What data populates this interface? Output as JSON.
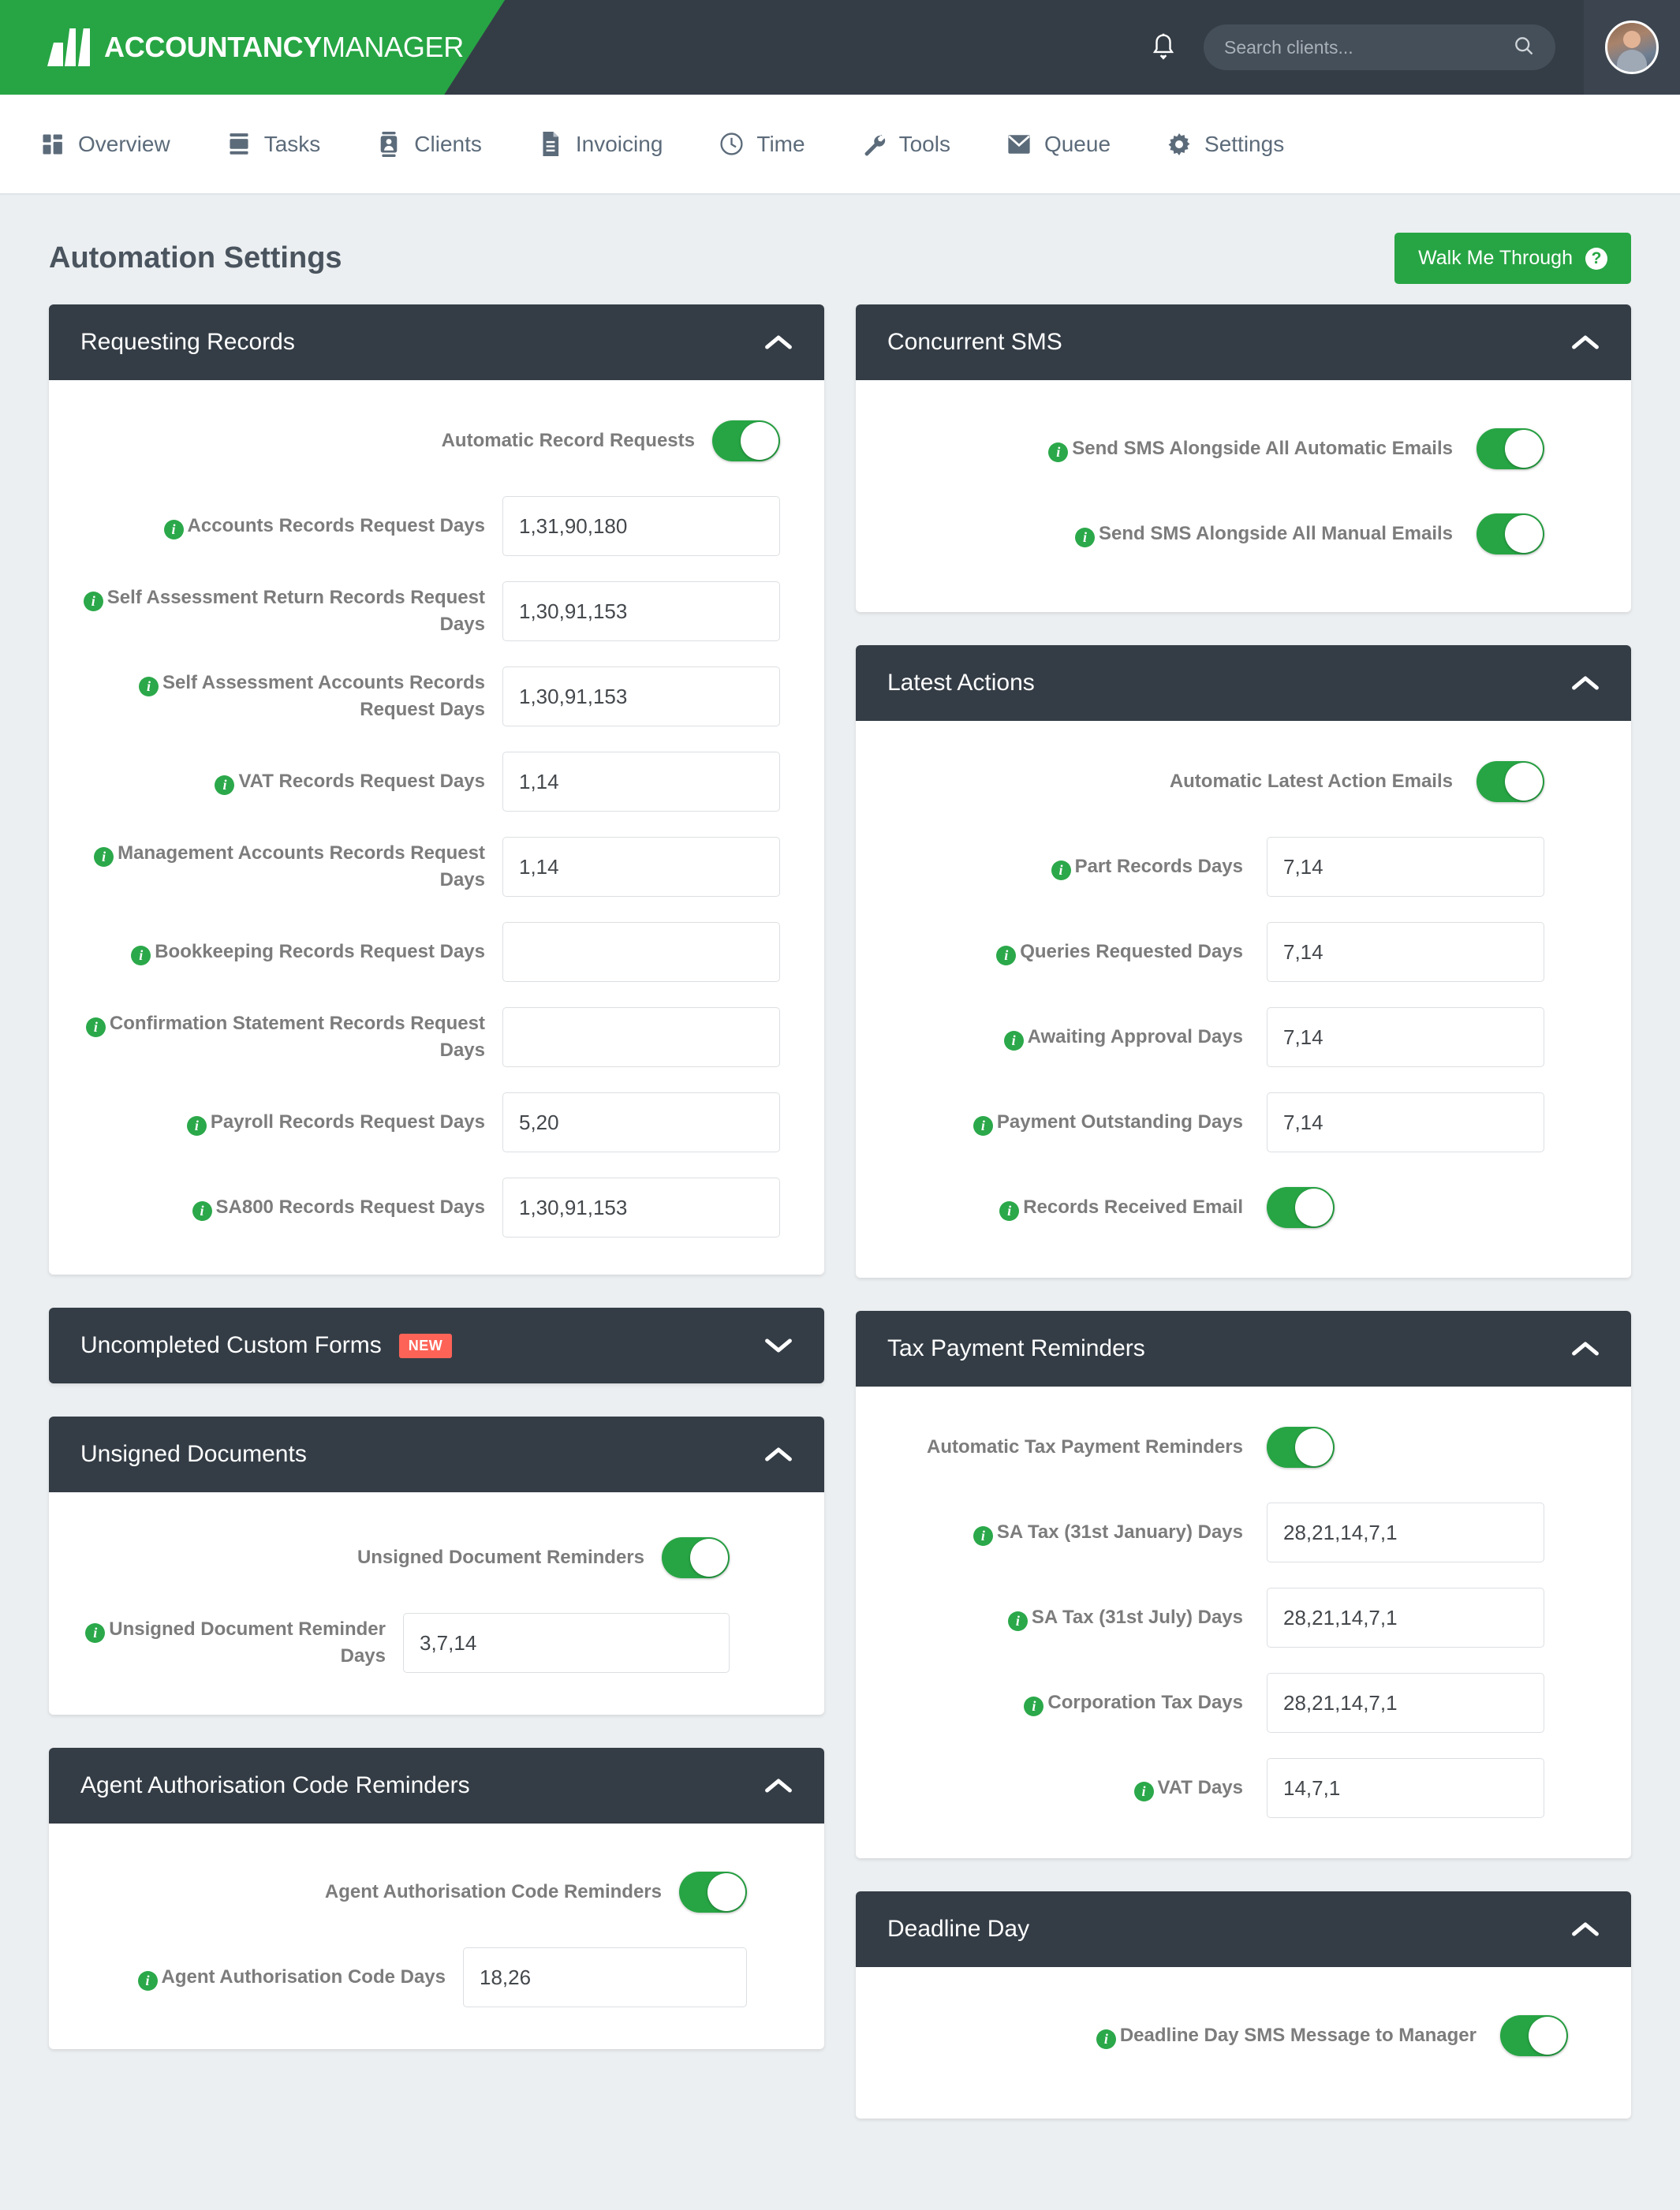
{
  "brand": {
    "bold": "ACCOUNTANCY",
    "light": "MANAGER"
  },
  "header": {
    "search_placeholder": "Search clients...",
    "bell_icon": "notification-bell-icon",
    "search_icon": "search-icon",
    "avatar": "user-avatar"
  },
  "nav": [
    {
      "label": "Overview",
      "icon": "grid-icon"
    },
    {
      "label": "Tasks",
      "icon": "tasks-icon"
    },
    {
      "label": "Clients",
      "icon": "contact-card-icon"
    },
    {
      "label": "Invoicing",
      "icon": "document-icon"
    },
    {
      "label": "Time",
      "icon": "clock-icon"
    },
    {
      "label": "Tools",
      "icon": "wrench-icon"
    },
    {
      "label": "Queue",
      "icon": "envelope-icon"
    },
    {
      "label": "Settings",
      "icon": "gear-icon"
    }
  ],
  "page": {
    "title": "Automation Settings",
    "walk_button": "Walk Me Through",
    "walk_icon": "question-mark-icon"
  },
  "colors": {
    "brand_green": "#27a544",
    "panel_header": "#343d46",
    "badge_new": "#fd6357",
    "page_bg": "#eceff1"
  },
  "panels": {
    "requesting_records": {
      "title": "Requesting Records",
      "collapsed": false,
      "chevron": "chevron-up-icon",
      "rows": [
        {
          "label": "Automatic Record Requests",
          "type": "toggle",
          "value": "on",
          "info": false
        },
        {
          "label": "Accounts Records Request Days",
          "type": "input",
          "value": "1,31,90,180",
          "info": true
        },
        {
          "label": "Self Assessment Return Records Request Days",
          "type": "input",
          "value": "1,30,91,153",
          "info": true
        },
        {
          "label": "Self Assessment Accounts Records Request Days",
          "type": "input",
          "value": "1,30,91,153",
          "info": true
        },
        {
          "label": "VAT Records Request Days",
          "type": "input",
          "value": "1,14",
          "info": true
        },
        {
          "label": "Management Accounts Records Request Days",
          "type": "input",
          "value": "1,14",
          "info": true
        },
        {
          "label": "Bookkeeping Records Request Days",
          "type": "input",
          "value": "",
          "info": true
        },
        {
          "label": "Confirmation Statement Records Request Days",
          "type": "input",
          "value": "",
          "info": true
        },
        {
          "label": "Payroll Records Request Days",
          "type": "input",
          "value": "5,20",
          "info": true
        },
        {
          "label": "SA800 Records Request Days",
          "type": "input",
          "value": "1,30,91,153",
          "info": true
        }
      ]
    },
    "uncompleted_custom_forms": {
      "title": "Uncompleted Custom Forms",
      "badge": "NEW",
      "collapsed": true,
      "chevron": "chevron-down-icon"
    },
    "unsigned_documents": {
      "title": "Unsigned Documents",
      "collapsed": false,
      "chevron": "chevron-up-icon",
      "rows": [
        {
          "label": "Unsigned Document Reminders",
          "type": "toggle",
          "value": "on",
          "info": false
        },
        {
          "label": "Unsigned Document Reminder Days",
          "type": "input",
          "value": "3,7,14",
          "info": true
        }
      ]
    },
    "agent_authorisation": {
      "title": "Agent Authorisation Code Reminders",
      "collapsed": false,
      "chevron": "chevron-up-icon",
      "rows": [
        {
          "label": "Agent Authorisation Code Reminders",
          "type": "toggle",
          "value": "on",
          "info": false
        },
        {
          "label": "Agent Authorisation Code Days",
          "type": "input",
          "value": "18,26",
          "info": true
        }
      ]
    },
    "concurrent_sms": {
      "title": "Concurrent SMS",
      "collapsed": false,
      "chevron": "chevron-up-icon",
      "rows": [
        {
          "label": "Send SMS Alongside All Automatic Emails",
          "type": "toggle",
          "value": "on",
          "info": true
        },
        {
          "label": "Send SMS Alongside All Manual Emails",
          "type": "toggle",
          "value": "on",
          "info": true
        }
      ]
    },
    "latest_actions": {
      "title": "Latest Actions",
      "collapsed": false,
      "chevron": "chevron-up-icon",
      "rows": [
        {
          "label": "Automatic Latest Action Emails",
          "type": "toggle",
          "value": "on",
          "info": false
        },
        {
          "label": "Part Records Days",
          "type": "input",
          "value": "7,14",
          "info": true
        },
        {
          "label": "Queries Requested Days",
          "type": "input",
          "value": "7,14",
          "info": true
        },
        {
          "label": "Awaiting Approval Days",
          "type": "input",
          "value": "7,14",
          "info": true
        },
        {
          "label": "Payment Outstanding Days",
          "type": "input",
          "value": "7,14",
          "info": true
        },
        {
          "label": "Records Received Email",
          "type": "toggle",
          "value": "on",
          "info": true
        }
      ]
    },
    "tax_payment_reminders": {
      "title": "Tax Payment Reminders",
      "collapsed": false,
      "chevron": "chevron-up-icon",
      "rows": [
        {
          "label": "Automatic Tax Payment Reminders",
          "type": "toggle",
          "value": "on",
          "info": false
        },
        {
          "label": "SA Tax (31st January) Days",
          "type": "input",
          "value": "28,21,14,7,1",
          "info": true
        },
        {
          "label": "SA Tax (31st July) Days",
          "type": "input",
          "value": "28,21,14,7,1",
          "info": true
        },
        {
          "label": "Corporation Tax Days",
          "type": "input",
          "value": "28,21,14,7,1",
          "info": true
        },
        {
          "label": "VAT Days",
          "type": "input",
          "value": "14,7,1",
          "info": true
        }
      ]
    },
    "deadline_day": {
      "title": "Deadline Day",
      "collapsed": false,
      "chevron": "chevron-up-icon",
      "rows": [
        {
          "label": "Deadline Day SMS Message to Manager",
          "type": "toggle",
          "value": "on",
          "info": true
        }
      ]
    }
  }
}
